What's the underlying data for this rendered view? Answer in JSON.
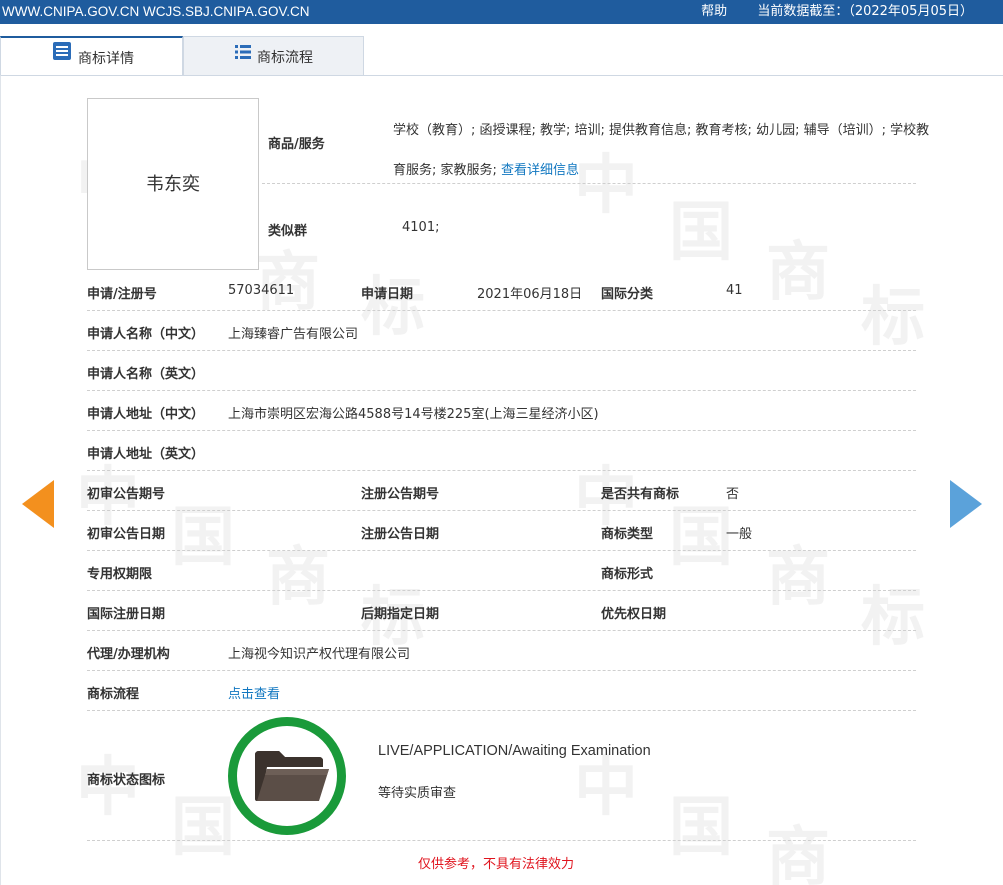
{
  "topbar": {
    "site": "WWW.CNIPA.GOV.CN WCJS.SBJ.CNIPA.GOV.CN",
    "help": "帮助",
    "data_date": "当前数据截至：（2022年05月05日）"
  },
  "tabs": [
    {
      "label": "商标详情",
      "icon": "document-list-icon",
      "active": true
    },
    {
      "label": "商标流程",
      "icon": "list-icon",
      "active": false
    }
  ],
  "trademark": {
    "name": "韦东奕",
    "goods_label": "商品/服务",
    "goods_text": "学校（教育）; 函授课程; 教学; 培训; 提供教育信息; 教育考核; 幼儿园; 辅导（培训）; 学校教育服务; 家教服务;",
    "goods_more": "查看详细信息",
    "similar_label": "类似群",
    "similar_value": "4101;"
  },
  "fields": {
    "reg_no_label": "申请/注册号",
    "reg_no": "57034611",
    "app_date_label": "申请日期",
    "app_date": "2021年06月18日",
    "intl_class_label": "国际分类",
    "intl_class": "41",
    "applicant_cn_label": "申请人名称（中文）",
    "applicant_cn": "上海臻睿广告有限公司",
    "applicant_en_label": "申请人名称（英文）",
    "applicant_en": "",
    "address_cn_label": "申请人地址（中文）",
    "address_cn": "上海市崇明区宏海公路4588号14号楼225室(上海三星经济小区)",
    "address_en_label": "申请人地址（英文）",
    "address_en": "",
    "prelim_pub_no_label": "初审公告期号",
    "reg_pub_no_label": "注册公告期号",
    "shared_label": "是否共有商标",
    "shared": "否",
    "prelim_pub_date_label": "初审公告日期",
    "reg_pub_date_label": "注册公告日期",
    "tm_type_label": "商标类型",
    "tm_type": "一般",
    "exclusive_period_label": "专用权期限",
    "tm_form_label": "商标形式",
    "intl_reg_date_label": "国际注册日期",
    "later_designation_label": "后期指定日期",
    "priority_date_label": "优先权日期",
    "agent_label": "代理/办理机构",
    "agent": "上海视今知识产权代理有限公司",
    "flow_label": "商标流程",
    "flow_link": "点击查看",
    "status_icon_label": "商标状态图标"
  },
  "status": {
    "english": "LIVE/APPLICATION/Awaiting Examination",
    "chinese": "等待实质审查",
    "ring_color": "#1a9a3a",
    "icon": "folder-icon"
  },
  "disclaimer": "仅供参考，不具有法律效力",
  "colors": {
    "topbar": "#1f5c9e",
    "link": "#1177c0",
    "prev_arrow": "#f3901e",
    "next_arrow": "#5ba2da",
    "disclaimer": "#e0141e"
  }
}
